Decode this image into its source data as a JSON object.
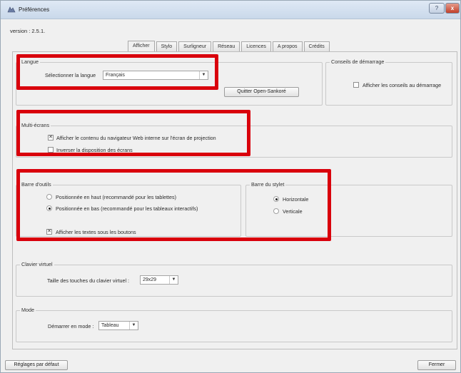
{
  "window": {
    "title": "Préférences",
    "help_label": "?",
    "close_label": "x"
  },
  "version_text": "version : 2.5.1.",
  "tabs": [
    {
      "label": "Afficher",
      "active": true
    },
    {
      "label": "Stylo",
      "active": false
    },
    {
      "label": "Surligneur",
      "active": false
    },
    {
      "label": "Réseau",
      "active": false
    },
    {
      "label": "Licences",
      "active": false
    },
    {
      "label": "A propos",
      "active": false
    },
    {
      "label": "Crédits",
      "active": false
    }
  ],
  "langue": {
    "title": "Langue",
    "select_label": "Sélectionner la langue",
    "select_value": "Français",
    "quit_button": "Quitter Open-Sankoré"
  },
  "conseils": {
    "title": "Conseils de démarrage",
    "checkbox_label": "Afficher les conseils au démarrage",
    "checked": false
  },
  "multi_ecrans": {
    "title": "Multi-écrans",
    "option1": {
      "label": "Afficher le contenu du navigateur Web interne sur l'écran de projection",
      "checked": true
    },
    "option2": {
      "label": "Inverser la disposition des écrans",
      "checked": false
    }
  },
  "barre_outils": {
    "title": "Barre d'outils",
    "radio_haut": {
      "label": "Positionnée en haut (recommandé pour les tablettes)",
      "selected": false
    },
    "radio_bas": {
      "label": "Positionnée en bas (recommandé pour les tableaux interactifs)",
      "selected": true
    },
    "textes_label": "Afficher les textes sous les boutons",
    "textes_checked": true
  },
  "barre_stylet": {
    "title": "Barre du stylet",
    "horizontale": {
      "label": "Horizontale",
      "selected": true
    },
    "verticale": {
      "label": "Verticale",
      "selected": false
    }
  },
  "clavier": {
    "title": "Clavier virtuel",
    "size_label": "Taille des touches du clavier virtuel :",
    "size_value": "29x29"
  },
  "mode": {
    "title": "Mode",
    "start_label": "Démarrer en mode :",
    "start_value": "Tableau"
  },
  "footer": {
    "reset_button": "Réglages par défaut",
    "close_button": "Fermer"
  },
  "colors": {
    "highlight": "#d9000c",
    "window_bg": "#f0f0f0"
  }
}
